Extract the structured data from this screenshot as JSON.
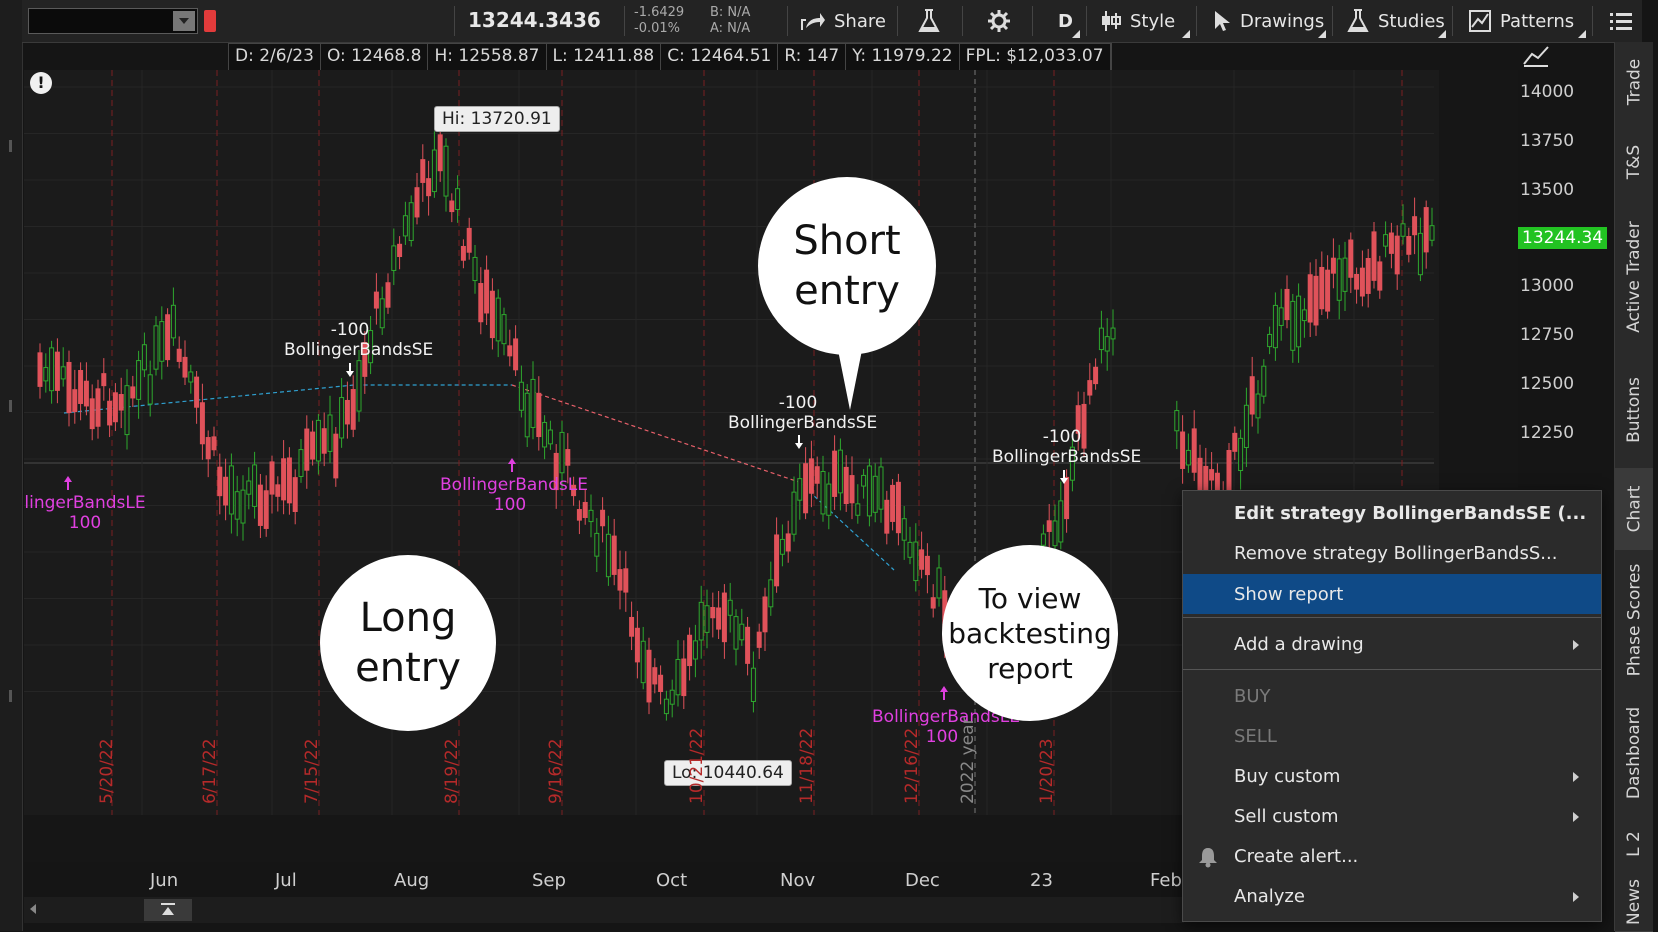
{
  "toolbar": {
    "symbol_value": "",
    "last_price": "13244.3436",
    "net_change": "-1.6429",
    "pct_change": "-0.01%",
    "bid": "B: N/A",
    "ask": "A: N/A",
    "share_label": "Share",
    "aggregation": "D",
    "style_label": "Style",
    "drawings_label": "Drawings",
    "studies_label": "Studies",
    "patterns_label": "Patterns"
  },
  "infobar": {
    "date": "D: 2/6/23",
    "open": "O: 12468.8",
    "high": "H: 12558.87",
    "low": "L: 12411.88",
    "close": "C: 12464.51",
    "range": "R: 147",
    "y": "Y: 11979.22",
    "fpl": "FPL: $12,033.07"
  },
  "chart": {
    "price_axis": [
      "14000",
      "13750",
      "13500",
      "13250",
      "13000",
      "12750",
      "12500",
      "12250"
    ],
    "last_price_tag": "13244.34",
    "month_labels": [
      "Jun",
      "Jul",
      "Aug",
      "Sep",
      "Oct",
      "Nov",
      "Dec",
      "23",
      "Feb"
    ],
    "expiry_dates": [
      "5/20/22",
      "6/17/22",
      "7/15/22",
      "8/19/22",
      "9/16/22",
      "10/21/22",
      "11/18/22",
      "12/16/22",
      "1/20/23"
    ],
    "year_marker": "2022 year",
    "hi_label": "Hi: 13720.91",
    "lo_label": "Lo: 10440.64",
    "signals": [
      {
        "top": "-100",
        "bottom": "BollingerBandsSE",
        "type": "short"
      },
      {
        "top": "BollingerBandsLE",
        "bottom": "100",
        "type": "long"
      },
      {
        "top": "-100",
        "bottom": "BollingerBandsSE",
        "type": "short"
      },
      {
        "top": "-100",
        "bottom": "BollingerBandsSE",
        "type": "short"
      },
      {
        "top": "BollingerBandsLE",
        "bottom": "100",
        "type": "long"
      },
      {
        "top": "lingerBandsLE",
        "bottom": "100",
        "type": "long"
      }
    ]
  },
  "callouts": {
    "short": [
      "Short",
      "entry"
    ],
    "long": [
      "Long",
      "entry"
    ],
    "report": [
      "To view",
      "backtesting",
      "report"
    ]
  },
  "context_menu": {
    "items": [
      {
        "label": "Edit strategy BollingerBandsSE (...",
        "bold": true
      },
      {
        "label": "Remove strategy BollingerBandsS..."
      },
      {
        "label": "Show report",
        "selected": true
      },
      {
        "label": "Add a drawing",
        "submenu": true
      },
      {
        "label": "BUY",
        "disabled": true
      },
      {
        "label": "SELL",
        "disabled": true
      },
      {
        "label": "Buy custom",
        "submenu": true
      },
      {
        "label": "Sell custom",
        "submenu": true
      },
      {
        "label": "Create alert...",
        "icon": "bell-icon"
      },
      {
        "label": "Analyze",
        "submenu": true
      }
    ]
  },
  "right_tabs": [
    "Trade",
    "T&S",
    "Active Trader",
    "Buttons",
    "Chart",
    "Phase Scores",
    "Dashboard",
    "L 2",
    "News"
  ],
  "colors": {
    "up": "#2ea82e",
    "down": "#e0525a",
    "accent": "#0f4a87",
    "last_price_bg": "#22c322",
    "signal_magenta": "#e040e0"
  }
}
